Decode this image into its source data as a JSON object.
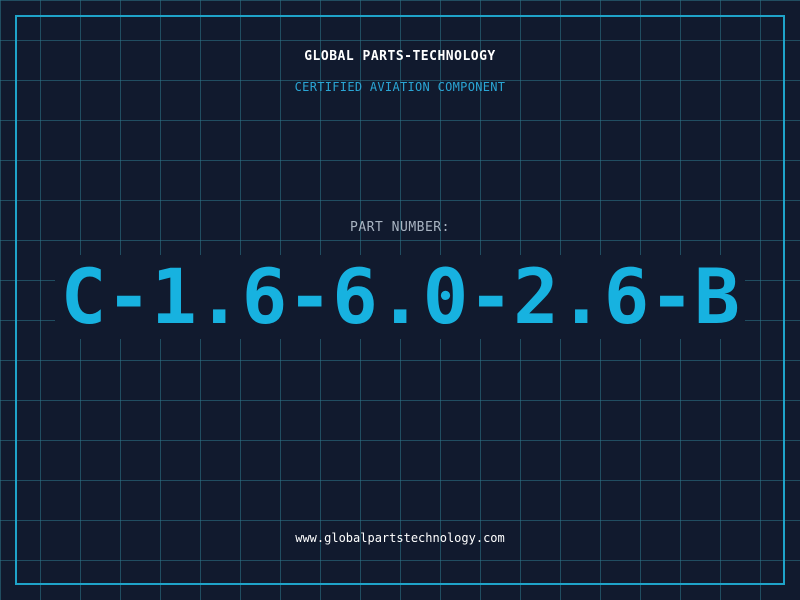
{
  "header": {
    "company": "GLOBAL PARTS-TECHNOLOGY",
    "subtitle": "CERTIFIED AVIATION COMPONENT"
  },
  "part": {
    "label": "PART NUMBER:",
    "number": "C-1.6-6.0-2.6-B"
  },
  "footer": {
    "website": "www.globalpartstechnology.com"
  },
  "colors": {
    "background": "#111a2e",
    "grid": "#2d768a",
    "frame": "#1fa3c9",
    "accent": "#17b2e0",
    "subtitle": "#2aa5d4",
    "label": "#a9b4c2",
    "text": "#ffffff"
  }
}
